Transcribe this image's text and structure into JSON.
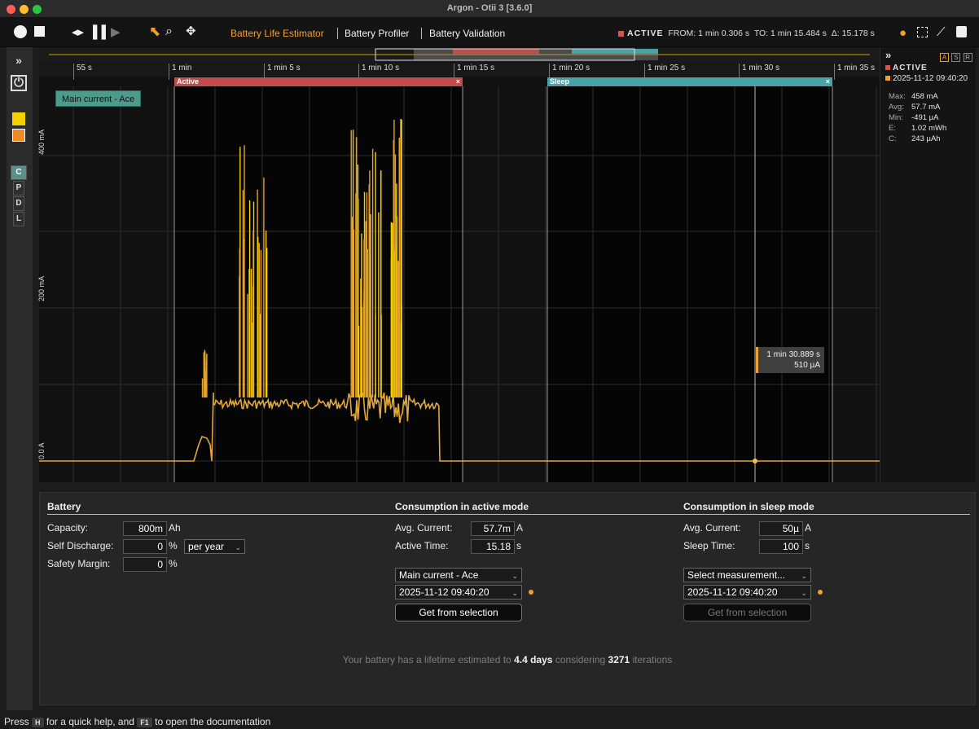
{
  "window": {
    "title": "Argon - Otii 3 [3.6.0]"
  },
  "toolbar": {
    "tabs": [
      "Battery Life Estimator",
      "Battery Profiler",
      "Battery Validation"
    ],
    "status_label": "ACTIVE",
    "from_label": "FROM:",
    "from_value": "1 min 0.306 s",
    "to_label": "TO:",
    "to_value": "1 min 15.484 s",
    "delta_label": "Δ:",
    "delta_value": "15.178 s",
    "accent": "#f0a030"
  },
  "rail": {
    "expand": "»",
    "buttons": [
      "C",
      "P",
      "D",
      "L"
    ],
    "swatches": [
      "#f5d000",
      "#f08a24"
    ]
  },
  "time_axis": {
    "ticks": [
      "55 s",
      "1 min",
      "1 min 5 s",
      "1 min 10 s",
      "1 min 15 s",
      "1 min 20 s",
      "1 min 25 s",
      "1 min 30 s",
      "1 min 35 s"
    ]
  },
  "segments": [
    {
      "label": "Active",
      "color": "#c24b4b",
      "close": "×"
    },
    {
      "label": "Sleep",
      "color": "#48a3a8",
      "close": "×"
    }
  ],
  "plot": {
    "legend": "Main current - Ace",
    "y_labels": [
      "400 mA",
      "200 mA",
      "0.0 A"
    ],
    "cursor_time": "1 min 30.889 s",
    "cursor_value": "510 µA"
  },
  "right_panel": {
    "expand": "»",
    "buttons": [
      "A",
      "S",
      "R"
    ],
    "status": "ACTIVE",
    "timestamp": "2025-11-12 09:40:20",
    "stats": [
      {
        "k": "Max:",
        "v": "458 mA"
      },
      {
        "k": "Avg:",
        "v": "57.7 mA"
      },
      {
        "k": "Min:",
        "v": "-491 µA"
      },
      {
        "k": "E:",
        "v": "1.02 mWh"
      },
      {
        "k": "C:",
        "v": "243 µAh"
      }
    ]
  },
  "battery": {
    "heading": "Battery",
    "capacity_label": "Capacity:",
    "capacity_value": "800m",
    "capacity_unit": "Ah",
    "self_discharge_label": "Self Discharge:",
    "self_discharge_value": "0",
    "self_discharge_unit": "%",
    "self_discharge_period": "per year",
    "safety_margin_label": "Safety Margin:",
    "safety_margin_value": "0",
    "safety_margin_unit": "%"
  },
  "active": {
    "heading": "Consumption in active mode",
    "avg_label": "Avg. Current:",
    "avg_value": "57.7m",
    "avg_unit": "A",
    "time_label": "Active Time:",
    "time_value": "15.18",
    "time_unit": "s",
    "measurement": "Main current - Ace",
    "recording": "2025-11-12 09:40:20",
    "button": "Get from selection"
  },
  "sleep": {
    "heading": "Consumption in sleep mode",
    "avg_label": "Avg. Current:",
    "avg_value": "50µ",
    "avg_unit": "A",
    "time_label": "Sleep Time:",
    "time_value": "100",
    "time_unit": "s",
    "measurement": "Select measurement...",
    "recording": "2025-11-12 09:40:20",
    "button": "Get from selection"
  },
  "summary": {
    "prefix": "Your battery has a lifetime estimated to",
    "lifetime": "4.4 days",
    "middle": "considering",
    "iterations": "3271",
    "suffix": "iterations"
  },
  "footer": {
    "press": "Press",
    "key1": "H",
    "mid": "for a quick help, and",
    "key2": "F1",
    "end": "to open the documentation"
  }
}
